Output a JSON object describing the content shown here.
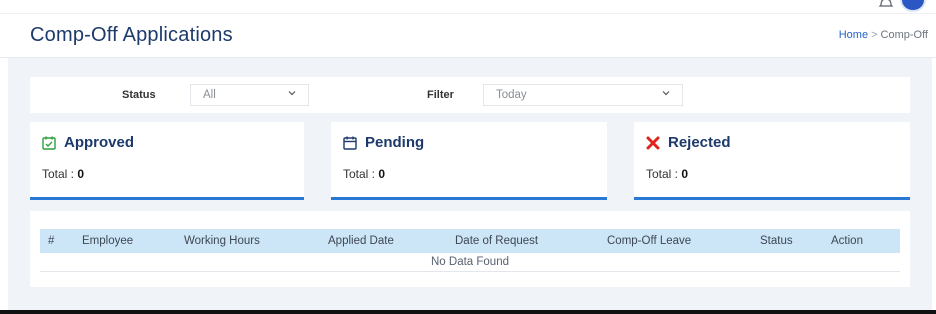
{
  "header": {
    "title": "Comp-Off Applications",
    "breadcrumb": {
      "home": "Home",
      "separator": ">",
      "current": "Comp-Off"
    }
  },
  "filters": {
    "status_label": "Status",
    "status_value": "All",
    "filter_label": "Filter",
    "filter_value": "Today"
  },
  "cards": {
    "approved": {
      "label": "Approved",
      "total_label": "Total :",
      "total": "0",
      "icon": "calendar-check-icon",
      "icon_color": "#2e9e3e"
    },
    "pending": {
      "label": "Pending",
      "total_label": "Total :",
      "total": "0",
      "icon": "calendar-icon",
      "icon_color": "#1d3a6b"
    },
    "rejected": {
      "label": "Rejected",
      "total_label": "Total :",
      "total": "0",
      "icon": "close-x-icon",
      "icon_color": "#e0241b"
    }
  },
  "table": {
    "columns": [
      "#",
      "Employee",
      "Working Hours",
      "Applied Date",
      "Date of Request",
      "Comp-Off Leave",
      "Status",
      "Action"
    ],
    "empty_text": "No Data Found"
  },
  "colors": {
    "accent": "#2a78d6",
    "title": "#1d3a6b",
    "table_header_bg": "#cde6f7",
    "page_bg": "#f0f3f7"
  }
}
